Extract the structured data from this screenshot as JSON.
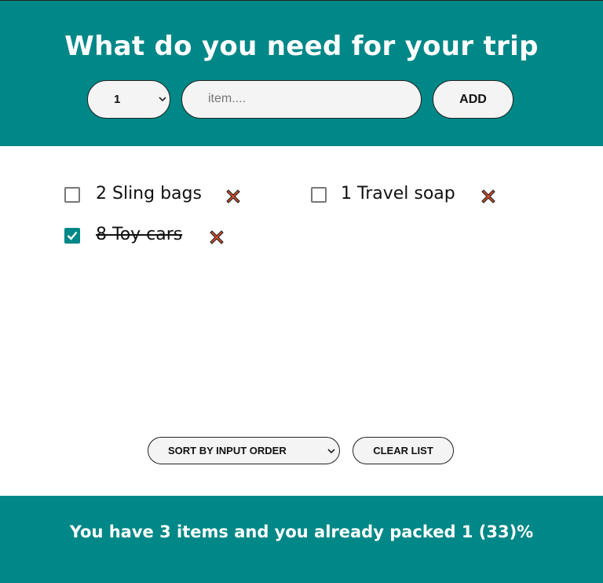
{
  "header": {
    "title": "What do you need for your trip",
    "quantity_value": "1",
    "item_placeholder": "item....",
    "add_label": "ADD"
  },
  "items": [
    {
      "text": "2 Sling bags",
      "packed": false
    },
    {
      "text": "1 Travel soap",
      "packed": false
    },
    {
      "text": "8 Toy cars",
      "packed": true
    }
  ],
  "controls": {
    "sort_value": "SORT BY INPUT ORDER",
    "clear_label": "CLEAR LIST"
  },
  "footer": {
    "stats_text": "You have 3 items and you already packed 1 (33)%"
  },
  "colors": {
    "accent": "#008787",
    "delete": "#e04e2a"
  },
  "icons": {
    "delete": "close-x-icon",
    "check": "checkmark-icon",
    "chevron": "chevron-down-icon"
  }
}
